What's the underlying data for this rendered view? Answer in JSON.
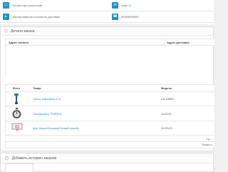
{
  "info": {
    "payment_method": "Оплата при получении",
    "shipping_method": "Фиксированная стоимость доставки",
    "email": "r@yk.ru",
    "phone": "89999999999"
  },
  "details": {
    "title": "Детали заказа",
    "payment_address_label": "Адрес оплаты",
    "shipping_address_label": "Адрес доставки"
  },
  "products": {
    "headers": {
      "photo": "Фото",
      "product": "Товар",
      "model": "Модель"
    },
    "rows": [
      {
        "name": "Свеча зажигания 6 кг",
        "model": "СК-33083",
        "image": "candle-icon"
      },
      {
        "name": "Секундомер TORRES",
        "model": "123/123",
        "image": "stopwatch-icon"
      },
      {
        "name": "Щит баскетбольный Новый хоккей",
        "model": "3123123",
        "image": "basketball-board-icon"
      }
    ],
    "totals": [
      "Су...",
      "Ваша к..."
    ]
  },
  "history": {
    "title": "Добавить историю заказов"
  },
  "colors": {
    "accent": "#1e91cf",
    "border": "#e6e6e6"
  }
}
